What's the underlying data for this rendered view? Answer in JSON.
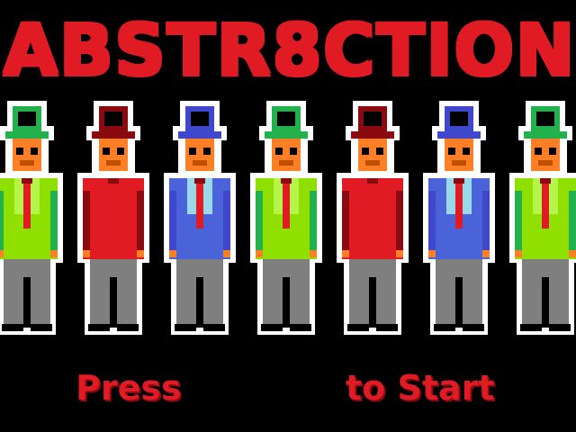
{
  "title": "ABSTR8CTION",
  "prompt": {
    "left_text": "Press",
    "right_text": "to Start"
  },
  "colors": {
    "title": "#e01b24",
    "background": "#000000"
  },
  "figures": [
    {
      "name": "green-figure",
      "hat": "#22b14c",
      "coat": "#8fe000",
      "shirt": "#b5f54a",
      "pants": "#7f7f7f"
    },
    {
      "name": "red-figure",
      "hat": "#8a0a10",
      "coat": "#e01b24",
      "shirt": "#e01b24",
      "pants": "#7f7f7f"
    },
    {
      "name": "blue-figure",
      "hat": "#3f48cc",
      "coat": "#4a63d8",
      "shirt": "#99d9ea",
      "pants": "#7f7f7f"
    },
    {
      "name": "green-figure",
      "hat": "#22b14c",
      "coat": "#8fe000",
      "shirt": "#b5f54a",
      "pants": "#7f7f7f"
    },
    {
      "name": "red-figure",
      "hat": "#8a0a10",
      "coat": "#e01b24",
      "shirt": "#e01b24",
      "pants": "#7f7f7f"
    },
    {
      "name": "blue-figure",
      "hat": "#3f48cc",
      "coat": "#4a63d8",
      "shirt": "#99d9ea",
      "pants": "#7f7f7f"
    },
    {
      "name": "green-figure",
      "hat": "#22b14c",
      "coat": "#8fe000",
      "shirt": "#b5f54a",
      "pants": "#7f7f7f"
    }
  ]
}
